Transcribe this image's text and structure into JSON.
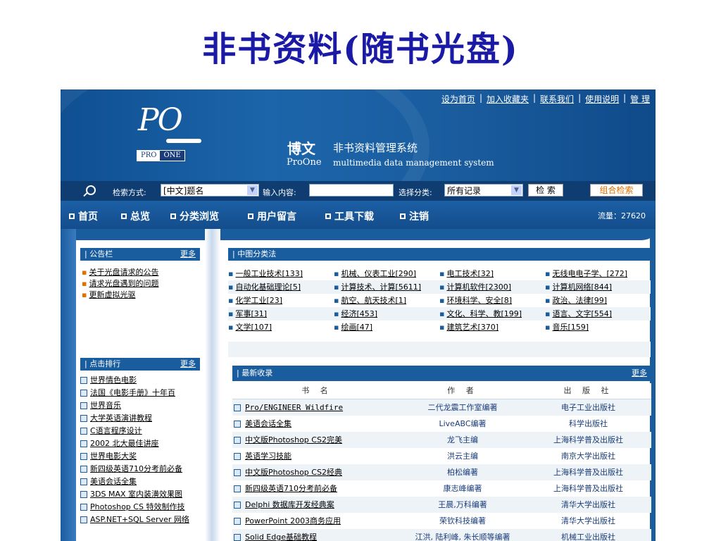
{
  "slide_title": "非书资料(随书光盘)",
  "top_links": [
    "设为首页",
    "加入收藏夹",
    "联系我们",
    "使用说明",
    "管 理"
  ],
  "logo": {
    "mark": "PO",
    "badge_left": "PRO",
    "badge_right": "ONE"
  },
  "brand": {
    "cn_name": "博文",
    "system_name": "非书资料管理系统",
    "en_name": "ProOne",
    "en_desc": "multimedia data management system"
  },
  "search": {
    "mode_label": "检索方式:",
    "mode_value": "[中文]题名",
    "input_label": "输入内容:",
    "input_value": "",
    "category_label": "选择分类:",
    "category_value": "所有记录",
    "search_button": "检 索",
    "combo_button": "组合检索"
  },
  "nav": [
    "首页",
    "总览",
    "分类浏览",
    "用户留言",
    "工具下载",
    "注销"
  ],
  "visits": "流量：27620",
  "notice_panel": {
    "title": "| 公告栏",
    "more": "更多",
    "items": [
      "关于光盘请求的公告",
      "请求光盘遇到的问题",
      "更新虚拟光驱"
    ]
  },
  "rank_panel": {
    "title": "| 点击排行",
    "more": "更多",
    "items": [
      "世界情色电影",
      "法国《电影手册》十年百",
      "世界音乐",
      "大学英语演讲教程",
      "C语言程序设计",
      "2002 北大最佳讲座",
      "世界电影大奖",
      "新四级英语710分考前必备",
      "美语会话全集",
      "3DS MAX 室内装潢效果图",
      "Photoshop CS 特效制作技",
      "ASP.NET+SQL Server 网络"
    ]
  },
  "category_panel": {
    "title": "| 中图分类法",
    "rows": [
      [
        "一般工业技术[133]",
        "机械、仪表工业[290]",
        "电工技术[32]",
        "无线电电子学、[272]"
      ],
      [
        "自动化基础理论[5]",
        "计算技术、计算[5611]",
        "计算机软件[2300]",
        "计算机网络[844]"
      ],
      [
        "化学工业[23]",
        "航空、航天技术[1]",
        "环境科学、安全[8]",
        "政治、法律[99]"
      ],
      [
        "军事[31]",
        "经济[453]",
        "文化、科学、教[199]",
        "语言、文字[554]"
      ],
      [
        "文学[107]",
        "绘画[47]",
        "建筑艺术[370]",
        "音乐[159]"
      ]
    ]
  },
  "new_panel": {
    "title": "| 最新收录",
    "more": "更多",
    "columns": [
      "书 名",
      "作 者",
      "出 版 社"
    ],
    "rows": [
      [
        "Pro/ENGINEER Wildfire",
        "二代龙震工作室编著",
        "电子工业出版社"
      ],
      [
        "美语会话全集",
        "LiveABC编著",
        "科学出版社"
      ],
      [
        "中文版Photoshop CS2完美",
        "龙飞主编",
        "上海科学普及出版社"
      ],
      [
        "英语学习技能",
        "洪云主编",
        "南京大学出版社"
      ],
      [
        "中文版Photoshop CS2经典",
        "柏松编著",
        "上海科学普及出版社"
      ],
      [
        "新四级英语710分考前必备",
        "康志峰编著",
        "上海科学普及出版社"
      ],
      [
        "Delphi 数据库开发经典案",
        "王晨,万科编著",
        "清华大学出版社"
      ],
      [
        "PowerPoint 2003商务应用",
        "荣钦科技编著",
        "清华大学出版社"
      ],
      [
        "Solid Edge基础教程",
        "江洪, 陆利峰, 朱长顺等编著",
        "机械工业出版社"
      ]
    ]
  }
}
